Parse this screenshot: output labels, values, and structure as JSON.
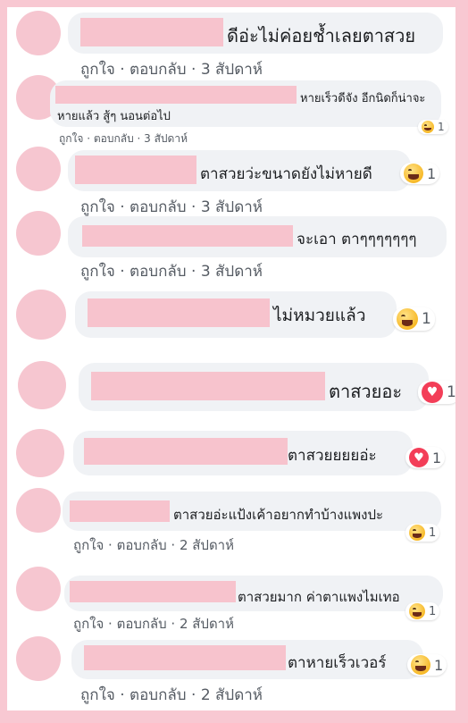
{
  "comments": [
    {
      "text": "ดีอ่ะไม่ค่อยช้ำเลยตาสวย",
      "meta": "ถูกใจ · ตอบกลับ · 3 สัปดาห์"
    },
    {
      "text": "หายเร็วดีจัง อีกนิดก็น่าจะ",
      "text2": "หายแล้ว สู้ๆ นอนต่อไป",
      "meta": "ถูกใจ · ตอบกลับ · 3 สัปดาห์",
      "reaction_count": "1"
    },
    {
      "text": "ตาสวยว่ะขนาดยังไม่หายดี",
      "meta": "ถูกใจ · ตอบกลับ · 3 สัปดาห์",
      "reaction_count": "1"
    },
    {
      "text": "จะเอา ตาๆๆๆๆๆๆๆ",
      "meta": "ถูกใจ · ตอบกลับ · 3 สัปดาห์"
    },
    {
      "text": "ไม่หมวยแล้ว",
      "reaction_count": "1"
    },
    {
      "text": "ตาสวยอะ",
      "reaction_count": "1"
    },
    {
      "text": "ตาสวยยยยอ่ะ",
      "reaction_count": "1"
    },
    {
      "text": "ตาสวยอ่ะแป้งเค้าอยากทำบ้างแพงปะ",
      "meta": "ถูกใจ · ตอบกลับ · 2 สัปดาห์",
      "reaction_count": "1"
    },
    {
      "text": "ตาสวยมาก ค่าตาแพงไมเทอ",
      "meta": "ถูกใจ · ตอบกลับ · 2 สัปดาห์",
      "reaction_count": "1"
    },
    {
      "text": "ตาหายเร็วเวอร์",
      "meta": "ถูกใจ · ตอบกลับ · 2 สัปดาห์",
      "reaction_count": "1"
    }
  ],
  "colors": {
    "page_border": "#f8c8d2",
    "bubble": "#f0f2f5",
    "redaction": "#f7c3cd",
    "heart": "#f33e58",
    "haha": "#f7b928"
  },
  "icons": {
    "haha": "haha-reaction-icon",
    "heart": "love-reaction-icon"
  }
}
